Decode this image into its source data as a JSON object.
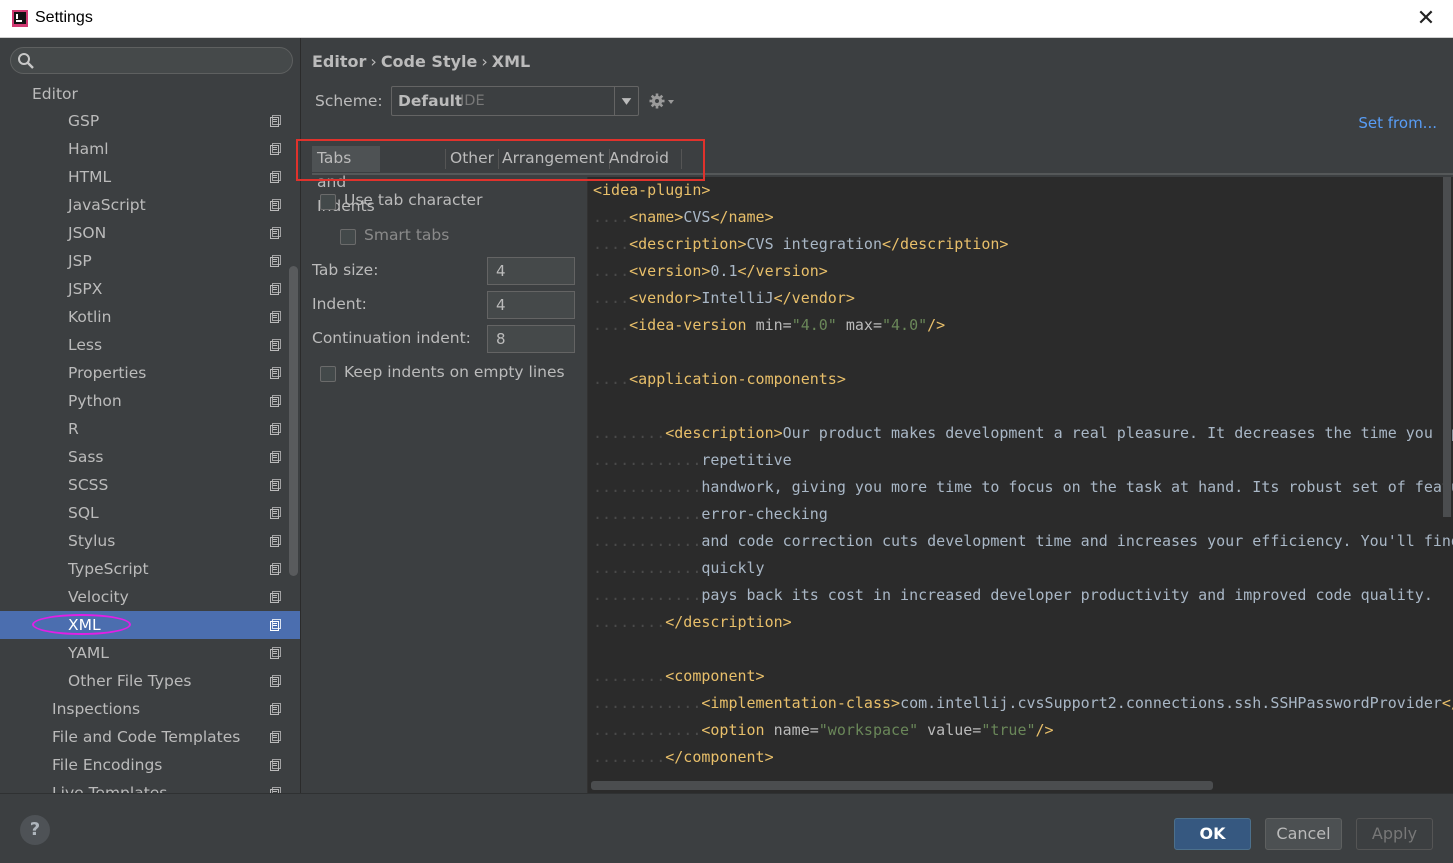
{
  "window": {
    "title": "Settings",
    "close_glyph": "✕"
  },
  "search": {
    "placeholder": "",
    "value": ""
  },
  "sidebar": {
    "section": "Editor",
    "items": [
      {
        "label": "GSP"
      },
      {
        "label": "Haml"
      },
      {
        "label": "HTML"
      },
      {
        "label": "JavaScript"
      },
      {
        "label": "JSON"
      },
      {
        "label": "JSP"
      },
      {
        "label": "JSPX"
      },
      {
        "label": "Kotlin"
      },
      {
        "label": "Less"
      },
      {
        "label": "Properties"
      },
      {
        "label": "Python"
      },
      {
        "label": "R"
      },
      {
        "label": "Sass"
      },
      {
        "label": "SCSS"
      },
      {
        "label": "SQL"
      },
      {
        "label": "Stylus"
      },
      {
        "label": "TypeScript"
      },
      {
        "label": "Velocity"
      },
      {
        "label": "XML",
        "selected": true
      },
      {
        "label": "YAML"
      },
      {
        "label": "Other File Types"
      }
    ],
    "top_items": [
      {
        "label": "Inspections"
      },
      {
        "label": "File and Code Templates"
      },
      {
        "label": "File Encodings"
      },
      {
        "label": "Live Templates"
      }
    ]
  },
  "breadcrumb": {
    "part1": "Editor",
    "part2": "Code Style",
    "part3": "XML",
    "sep": "›"
  },
  "scheme": {
    "label": "Scheme:",
    "name": "Default",
    "sub": "IDE"
  },
  "set_from": "Set from...",
  "tabs": [
    "Tabs and Indents",
    "Other",
    "Arrangement",
    "Android"
  ],
  "options": {
    "use_tab_character": "Use tab character",
    "smart_tabs": "Smart tabs",
    "tab_size_label": "Tab size:",
    "tab_size": "4",
    "indent_label": "Indent:",
    "indent": "4",
    "continuation_label": "Continuation indent:",
    "continuation": "8",
    "keep_indents": "Keep indents on empty lines"
  },
  "code_lines": [
    [
      [
        "tg",
        "<idea-plugin>"
      ]
    ],
    [
      [
        "ws",
        "...."
      ],
      [
        "tg",
        "<name>"
      ],
      [
        "tx",
        "CVS"
      ],
      [
        "tg",
        "</name>"
      ]
    ],
    [
      [
        "ws",
        "...."
      ],
      [
        "tg",
        "<description>"
      ],
      [
        "tx",
        "CVS integration"
      ],
      [
        "tg",
        "</description>"
      ]
    ],
    [
      [
        "ws",
        "...."
      ],
      [
        "tg",
        "<version>"
      ],
      [
        "tx",
        "0.1"
      ],
      [
        "tg",
        "</version>"
      ]
    ],
    [
      [
        "ws",
        "...."
      ],
      [
        "tg",
        "<vendor>"
      ],
      [
        "tx",
        "IntelliJ"
      ],
      [
        "tg",
        "</vendor>"
      ]
    ],
    [
      [
        "ws",
        "...."
      ],
      [
        "tg",
        "<idea-version "
      ],
      [
        "at",
        "min="
      ],
      [
        "av",
        "\"4.0\""
      ],
      [
        "at",
        " max="
      ],
      [
        "av",
        "\"4.0\""
      ],
      [
        "tg",
        "/>"
      ]
    ],
    [],
    [
      [
        "ws",
        "...."
      ],
      [
        "tg",
        "<application-components>"
      ]
    ],
    [],
    [
      [
        "ws",
        "........"
      ],
      [
        "tg",
        "<description>"
      ],
      [
        "tx",
        "Our product makes development a real pleasure. It decreases the time you spend on routine,"
      ]
    ],
    [
      [
        "ws",
        "............"
      ],
      [
        "tx",
        "repetitive"
      ]
    ],
    [
      [
        "ws",
        "............"
      ],
      [
        "tx",
        "handwork, giving you more time to focus on the task at hand. Its robust set of features,"
      ]
    ],
    [
      [
        "ws",
        "............"
      ],
      [
        "tx",
        "error-checking"
      ]
    ],
    [
      [
        "ws",
        "............"
      ],
      [
        "tx",
        "and code correction cuts development time and increases your efficiency. You'll find that it"
      ]
    ],
    [
      [
        "ws",
        "............"
      ],
      [
        "tx",
        "quickly"
      ]
    ],
    [
      [
        "ws",
        "............"
      ],
      [
        "tx",
        "pays back its cost in increased developer productivity and improved code quality."
      ]
    ],
    [
      [
        "ws",
        "........"
      ],
      [
        "tg",
        "</description>"
      ]
    ],
    [],
    [
      [
        "ws",
        "........"
      ],
      [
        "tg",
        "<component>"
      ]
    ],
    [
      [
        "ws",
        "............"
      ],
      [
        "tg",
        "<implementation-class>"
      ],
      [
        "tx",
        "com.intellij.cvsSupport2.connections.ssh.SSHPasswordProvider"
      ],
      [
        "tg",
        "</implementation-class>"
      ]
    ],
    [
      [
        "ws",
        "............"
      ],
      [
        "tg",
        "<option "
      ],
      [
        "at",
        "name="
      ],
      [
        "av",
        "\"workspace\""
      ],
      [
        "at",
        " value="
      ],
      [
        "av",
        "\"true\""
      ],
      [
        "tg",
        "/>"
      ]
    ],
    [
      [
        "ws",
        "........"
      ],
      [
        "tg",
        "</component>"
      ]
    ]
  ],
  "footer": {
    "help": "?",
    "ok": "OK",
    "cancel": "Cancel",
    "apply": "Apply"
  },
  "colors": {
    "selection": "#4b6eaf",
    "accent_link": "#589df6",
    "annotation_red": "#e0322c",
    "annotation_magenta": "#e11fe6"
  }
}
